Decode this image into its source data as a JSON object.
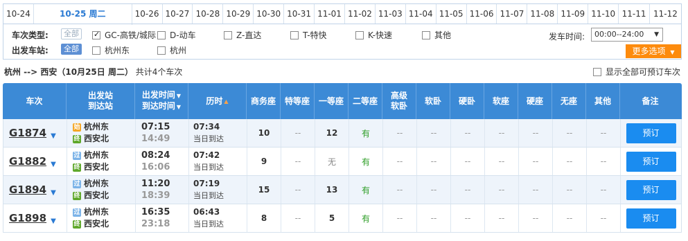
{
  "date_tabs": [
    {
      "label": "10-24",
      "active": false
    },
    {
      "label": "10-25 周二",
      "active": true
    },
    {
      "label": "10-26",
      "active": false
    },
    {
      "label": "10-27",
      "active": false
    },
    {
      "label": "10-28",
      "active": false
    },
    {
      "label": "10-29",
      "active": false
    },
    {
      "label": "10-30",
      "active": false
    },
    {
      "label": "10-31",
      "active": false
    },
    {
      "label": "11-01",
      "active": false
    },
    {
      "label": "11-02",
      "active": false
    },
    {
      "label": "11-03",
      "active": false
    },
    {
      "label": "11-04",
      "active": false
    },
    {
      "label": "11-05",
      "active": false
    },
    {
      "label": "11-06",
      "active": false
    },
    {
      "label": "11-07",
      "active": false
    },
    {
      "label": "11-08",
      "active": false
    },
    {
      "label": "11-09",
      "active": false
    },
    {
      "label": "11-10",
      "active": false
    },
    {
      "label": "11-11",
      "active": false
    },
    {
      "label": "11-12",
      "active": false
    }
  ],
  "filters": {
    "train_type_label": "车次类型:",
    "all_label": "全部",
    "train_types": [
      {
        "label": "GC-高铁/城际",
        "checked": true
      },
      {
        "label": "D-动车",
        "checked": false
      },
      {
        "label": "Z-直达",
        "checked": false
      },
      {
        "label": "T-特快",
        "checked": false
      },
      {
        "label": "K-快速",
        "checked": false
      },
      {
        "label": "其他",
        "checked": false
      }
    ],
    "station_label": "出发车站:",
    "stations": [
      {
        "label": "杭州东",
        "checked": false
      },
      {
        "label": "杭州",
        "checked": false
      }
    ],
    "time_label": "发车时间:",
    "time_value": "00:00--24:00",
    "more_label": "更多选项"
  },
  "summary": {
    "route": "杭州 --> 西安（10月25日  周二）",
    "count": "共计4个车次",
    "show_all_label": "显示全部可预订车次"
  },
  "table": {
    "headers": {
      "train": "车次",
      "station_top": "出发站",
      "station_bottom": "到达站",
      "time_top": "出发时间",
      "time_bottom": "到达时间",
      "duration": "历时",
      "business": "商务座",
      "premium": "特等座",
      "first": "一等座",
      "second": "二等座",
      "soft_sleeper_top": "高级",
      "soft_sleeper_bottom": "软卧",
      "soft_berth": "软卧",
      "hard_berth": "硬卧",
      "soft_seat": "软座",
      "hard_seat": "硬座",
      "no_seat": "无座",
      "other": "其他",
      "note": "备注"
    },
    "rows": [
      {
        "train": "G1874",
        "from": "杭州东",
        "from_icon": "始",
        "to": "西安北",
        "to_icon": "终",
        "dep": "07:15",
        "arr": "14:49",
        "dur": "07:34",
        "arrive_day": "当日到达",
        "business": "10",
        "premium": "--",
        "first": "12",
        "second": "有",
        "gaoji": "--",
        "ruanwo": "--",
        "yingwo": "--",
        "ruanzuo": "--",
        "yingzuo": "--",
        "wuzuo": "--",
        "other": "--",
        "book": "预订"
      },
      {
        "train": "G1882",
        "from": "杭州东",
        "from_icon": "过",
        "to": "西安北",
        "to_icon": "终",
        "dep": "08:24",
        "arr": "16:06",
        "dur": "07:42",
        "arrive_day": "当日到达",
        "business": "9",
        "premium": "--",
        "first": "无",
        "second": "有",
        "gaoji": "--",
        "ruanwo": "--",
        "yingwo": "--",
        "ruanzuo": "--",
        "yingzuo": "--",
        "wuzuo": "--",
        "other": "--",
        "book": "预订"
      },
      {
        "train": "G1894",
        "from": "杭州东",
        "from_icon": "过",
        "to": "西安北",
        "to_icon": "终",
        "dep": "11:20",
        "arr": "18:39",
        "dur": "07:19",
        "arrive_day": "当日到达",
        "business": "15",
        "premium": "--",
        "first": "13",
        "second": "有",
        "gaoji": "--",
        "ruanwo": "--",
        "yingwo": "--",
        "ruanzuo": "--",
        "yingzuo": "--",
        "wuzuo": "--",
        "other": "--",
        "book": "预订"
      },
      {
        "train": "G1898",
        "from": "杭州东",
        "from_icon": "过",
        "to": "西安北",
        "to_icon": "终",
        "dep": "16:35",
        "arr": "23:18",
        "dur": "06:43",
        "arrive_day": "当日到达",
        "business": "8",
        "premium": "--",
        "first": "5",
        "second": "有",
        "gaoji": "--",
        "ruanwo": "--",
        "yingwo": "--",
        "ruanzuo": "--",
        "yingzuo": "--",
        "wuzuo": "--",
        "other": "--",
        "book": "预订"
      }
    ]
  },
  "colors": {
    "header_blue": "#3c8ad6",
    "book_button": "#1a8cf0",
    "more_button": "#fd8b0d",
    "available_green": "#2e9e27"
  }
}
